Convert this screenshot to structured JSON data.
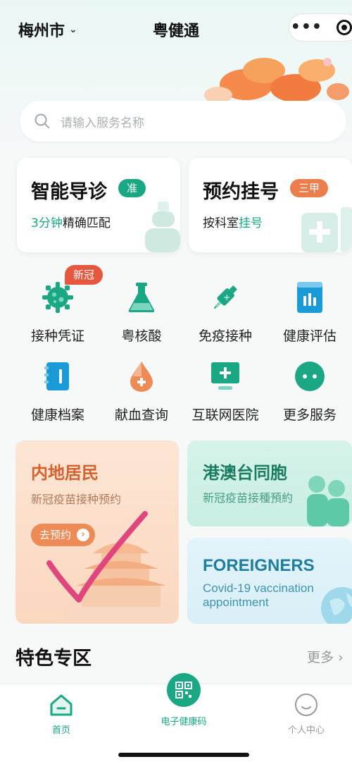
{
  "topbar": {
    "city": "梅州市",
    "title": "粤健通",
    "more_glyph": "•••"
  },
  "search": {
    "placeholder": "请输入服务名称"
  },
  "cards": {
    "triage": {
      "title": "智能导诊",
      "badge": "准",
      "sub_green": "3分钟",
      "sub_rest": "精确匹配",
      "badge_color": "#1aa884"
    },
    "register": {
      "title": "预约挂号",
      "badge": "三甲",
      "sub_rest": "按科室",
      "sub_green": "挂号",
      "badge_color": "#ec7e4e"
    }
  },
  "new_tag": "新冠",
  "services": [
    {
      "label": "接种凭证",
      "icon": "gear-virus-icon"
    },
    {
      "label": "粤核酸",
      "icon": "flask-icon"
    },
    {
      "label": "免疫接种",
      "icon": "syringe-icon"
    },
    {
      "label": "健康评估",
      "icon": "bar-chart-icon"
    },
    {
      "label": "健康档案",
      "icon": "notebook-icon"
    },
    {
      "label": "献血查询",
      "icon": "blood-drop-icon"
    },
    {
      "label": "互联网医院",
      "icon": "monitor-plus-icon"
    },
    {
      "label": "更多服务",
      "icon": "more-dots-icon"
    }
  ],
  "promos": {
    "mainland": {
      "title": "内地居民",
      "subtitle": "新冠疫苗接种预约",
      "button": "去预约"
    },
    "hmt": {
      "title": "港澳台同胞",
      "subtitle": "新冠疫苗接種預約"
    },
    "foreigners": {
      "title": "FOREIGNERS",
      "subtitle_line1": "Covid-19 vaccination",
      "subtitle_line2": "appointment"
    }
  },
  "section": {
    "title": "特色专区",
    "more": "更多"
  },
  "tabbar": {
    "home": "首页",
    "health_code": "电子健康码",
    "profile": "个人中心"
  },
  "colors": {
    "brand_green": "#1aa884",
    "accent_orange": "#ec7e4e",
    "new_tag_red": "#e5573f",
    "check_mark_pink": "#e0457d"
  }
}
